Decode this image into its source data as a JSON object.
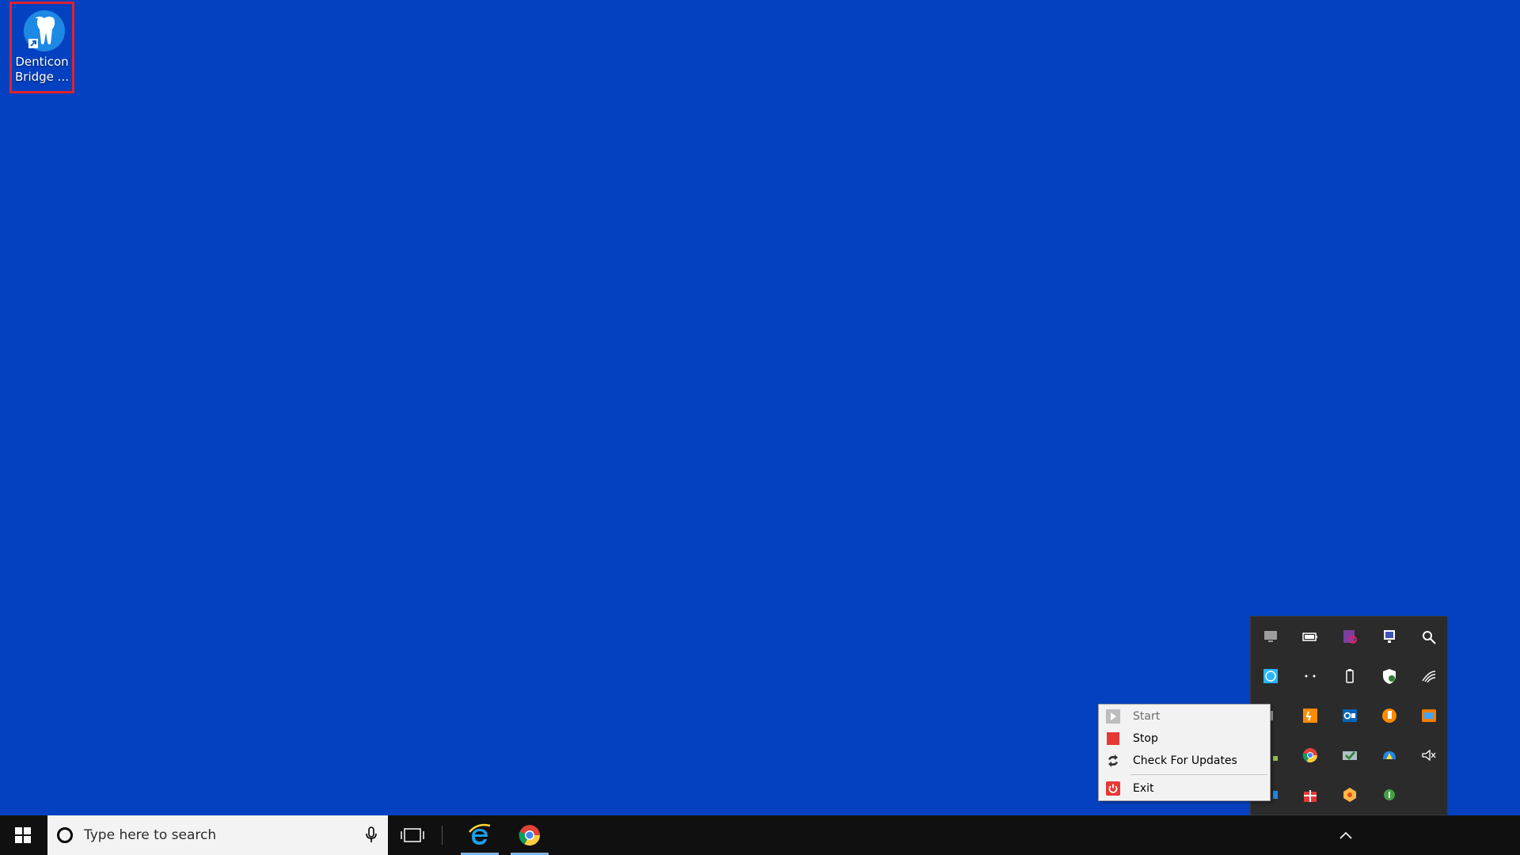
{
  "desktop": {
    "icons": [
      {
        "label": "Denticon Bridge ...",
        "icon": "tooth-globe-icon",
        "selected": true
      }
    ],
    "background_color": "#0341C1"
  },
  "context_menu": {
    "items": [
      {
        "label": "Start",
        "icon": "play-icon",
        "disabled": true
      },
      {
        "label": "Stop",
        "icon": "stop-icon",
        "disabled": false
      },
      {
        "label": "Check For Updates",
        "icon": "refresh-icon",
        "disabled": false
      },
      {
        "label": "Exit",
        "icon": "power-icon",
        "disabled": false
      }
    ]
  },
  "tray_overflow": {
    "icons": [
      "monitor-icon",
      "battery-icon",
      "onenote-clip-icon",
      "display-manager-icon",
      "satellite-icon",
      "network-globe-icon",
      "dots-icon",
      "usb-drive-icon",
      "defender-shield-icon",
      "wifi-icon",
      "green-app-icon",
      "orange-app-icon",
      "outlook-icon",
      "chart-icon",
      "remote-icon",
      "lime-app-icon",
      "chrome-icon",
      "checkmark-tray-icon",
      "cloud-icon",
      "speaker-muted-icon",
      "blue-app-icon",
      "gift-icon",
      "gear-app-icon",
      "green-badge-icon"
    ]
  },
  "taskbar": {
    "search_placeholder": "Type here to search",
    "pinned": [
      {
        "name": "internet-explorer",
        "active": true
      },
      {
        "name": "google-chrome",
        "active": true
      }
    ]
  }
}
